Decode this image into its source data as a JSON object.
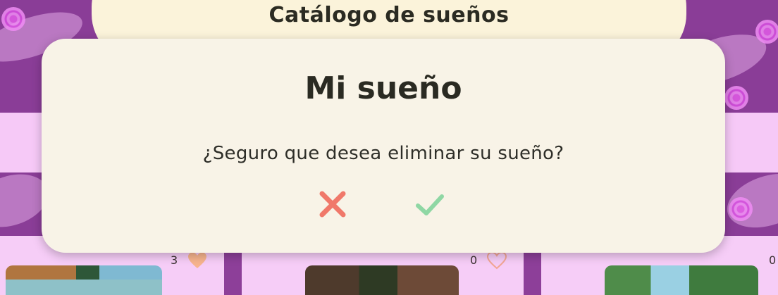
{
  "header": {
    "title": "Catálogo de sueños"
  },
  "dialog": {
    "title": "Mi sueño",
    "message": "¿Seguro que desea eliminar su sueño?",
    "cancel_icon": "close-icon",
    "confirm_icon": "check-icon",
    "cancel_color": "#f0786a",
    "confirm_color": "#8fd7a4"
  },
  "cards": [
    {
      "likes": "3",
      "liked": true
    },
    {
      "likes": "0",
      "liked": false
    },
    {
      "likes": "0",
      "liked": false
    }
  ],
  "colors": {
    "background_purple": "#8d3f99",
    "card_pink": "#f6cdf7",
    "header_cream": "#fbf3da",
    "modal_cream": "#f8f3e7",
    "heart_filled": "#f7b48e",
    "heart_outline": "#f2a694"
  }
}
